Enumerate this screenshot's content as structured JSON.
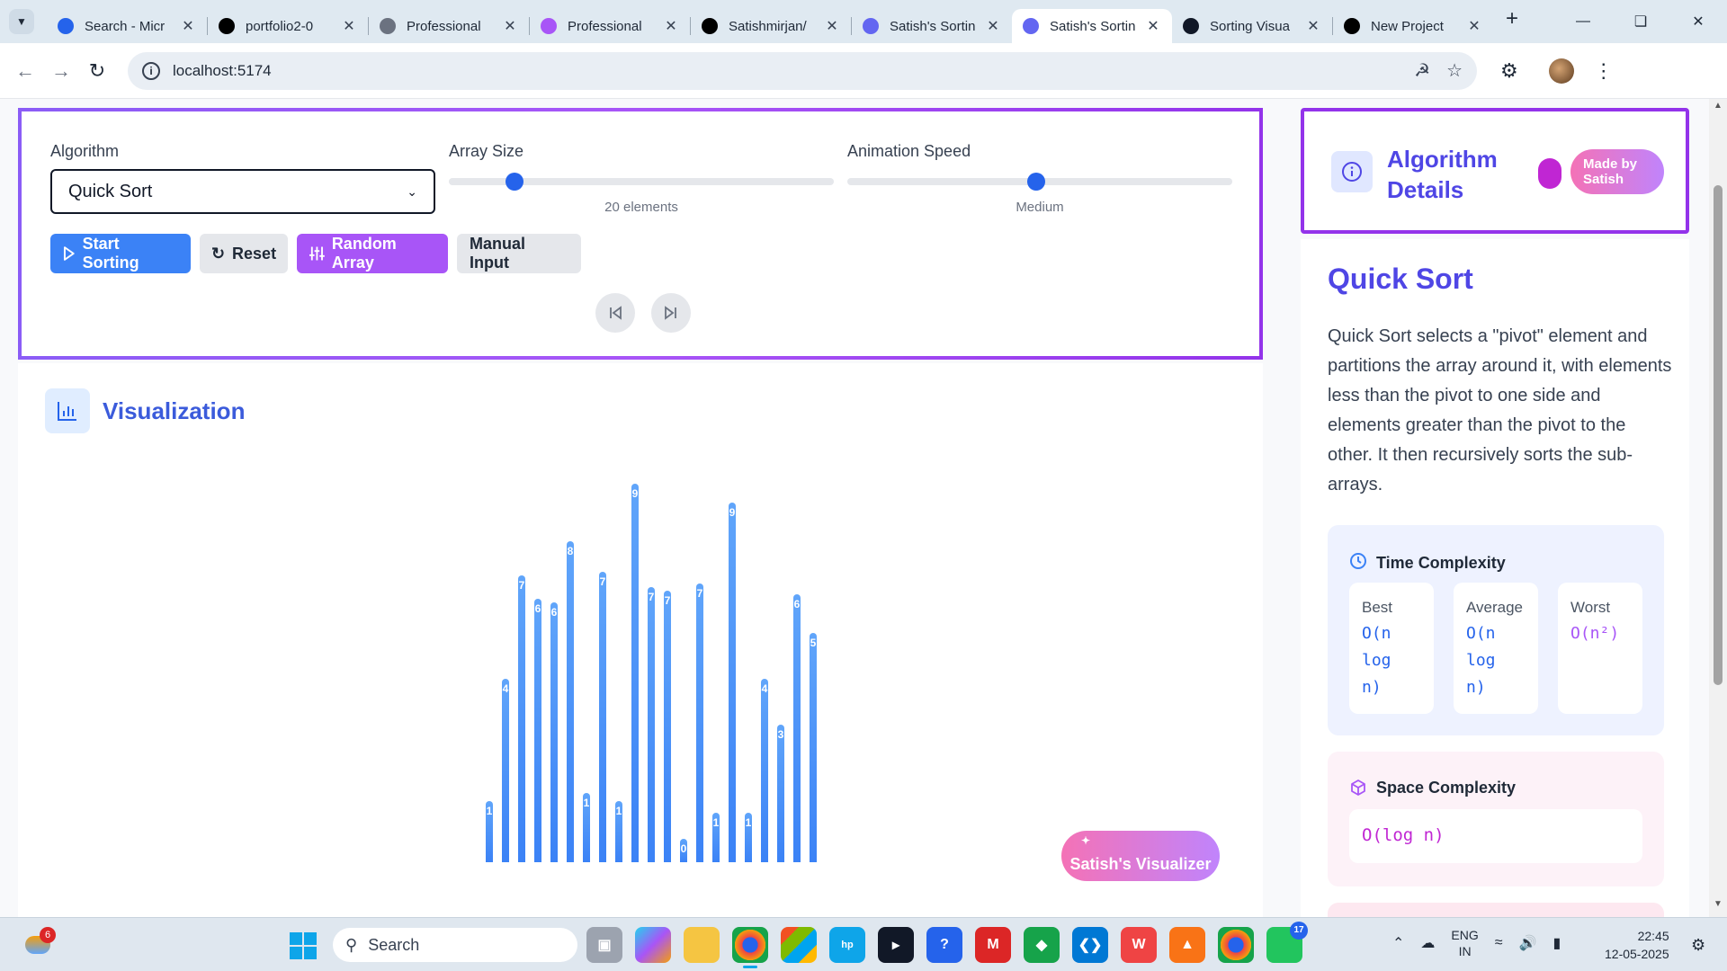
{
  "browser": {
    "tabs": [
      {
        "title": "Search - Micr",
        "icon": "search-icon",
        "color": "#2563eb"
      },
      {
        "title": "portfolio2-0",
        "icon": "vercel-icon",
        "color": "#000000"
      },
      {
        "title": "Professional",
        "icon": "globe-icon",
        "color": "#6b7280"
      },
      {
        "title": "Professional",
        "icon": "vite-icon",
        "color": "#a855f7"
      },
      {
        "title": "Satishmirjan/",
        "icon": "github-icon",
        "color": "#000000"
      },
      {
        "title": "Satish's Sortin",
        "icon": "app-icon",
        "color": "#6366f1"
      },
      {
        "title": "Satish's Sortin",
        "icon": "app-icon",
        "color": "#6366f1",
        "active": true
      },
      {
        "title": "Sorting Visua",
        "icon": "openai-icon",
        "color": "#111827"
      },
      {
        "title": "New Project",
        "icon": "vercel-icon",
        "color": "#000000"
      }
    ],
    "url": "localhost:5174"
  },
  "controls": {
    "algorithm_label": "Algorithm",
    "algorithm_value": "Quick Sort",
    "array_size_label": "Array Size",
    "array_size_caption": "20 elements",
    "array_size_fraction": 0.17,
    "speed_label": "Animation Speed",
    "speed_caption": "Medium",
    "speed_fraction": 0.49,
    "buttons": {
      "start": "Start Sorting",
      "reset": "Reset",
      "random": "Random Array",
      "manual": "Manual Input"
    }
  },
  "visualization": {
    "title": "Visualization",
    "badge": "Satish's Visualizer",
    "bars": [
      {
        "value": 1.6,
        "label": "1"
      },
      {
        "value": 4.8,
        "label": "4"
      },
      {
        "value": 7.5,
        "label": "7"
      },
      {
        "value": 6.9,
        "label": "6"
      },
      {
        "value": 6.8,
        "label": "6"
      },
      {
        "value": 8.4,
        "label": "8"
      },
      {
        "value": 1.8,
        "label": "1"
      },
      {
        "value": 7.6,
        "label": "7"
      },
      {
        "value": 1.6,
        "label": "1"
      },
      {
        "value": 9.9,
        "label": "9"
      },
      {
        "value": 7.2,
        "label": "7"
      },
      {
        "value": 7.1,
        "label": "7"
      },
      {
        "value": 0.6,
        "label": "0"
      },
      {
        "value": 7.3,
        "label": "7"
      },
      {
        "value": 1.3,
        "label": "1"
      },
      {
        "value": 9.4,
        "label": "9"
      },
      {
        "value": 1.3,
        "label": "1"
      },
      {
        "value": 4.8,
        "label": "4"
      },
      {
        "value": 3.6,
        "label": "3"
      },
      {
        "value": 7.0,
        "label": "6"
      },
      {
        "value": 6.0,
        "label": "5"
      }
    ]
  },
  "details": {
    "header_title": "Algorithm Details",
    "made_by": "Made by Satish",
    "algo_name": "Quick Sort",
    "description": "Quick Sort selects a \"pivot\" element and partitions the array around it, with elements less than the pivot to one side and elements greater than the pivot to the other. It then recursively sorts the sub-arrays.",
    "time_title": "Time Complexity",
    "best_label": "Best",
    "best_value": "O(n log n)",
    "avg_label": "Average",
    "avg_value": "O(n log n)",
    "worst_label": "Worst",
    "worst_value": "O(n²)",
    "space_title": "Space Complexity",
    "space_value": "O(log n)"
  },
  "taskbar": {
    "weather_count": "6",
    "search_placeholder": "Search",
    "lang_line1": "ENG",
    "lang_line2": "IN",
    "time": "22:45",
    "date": "12-05-2025",
    "whatsapp_count": "17"
  },
  "colors": {
    "accent_blue": "#3b82f6",
    "accent_purple": "#a855f7",
    "title_indigo": "#4f46e5"
  }
}
